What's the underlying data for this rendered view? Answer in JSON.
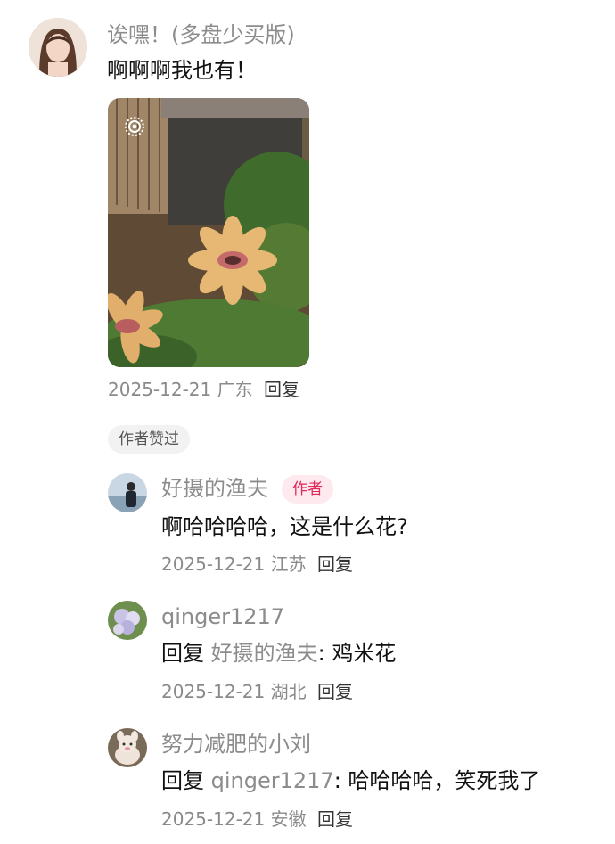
{
  "comments": [
    {
      "user": "诶嘿！(多盘少买版)",
      "text": "啊啊啊我也有！",
      "date": "2025-12-21",
      "location": "广东",
      "reply_label": "回复",
      "badge": "作者赞过"
    }
  ],
  "replies": [
    {
      "user": "好摄的渔夫",
      "author_tag": "作者",
      "text": "啊哈哈哈哈，这是什么花?",
      "date": "2025-12-21",
      "location": "江苏",
      "reply_label": "回复"
    },
    {
      "user": "qinger1217",
      "reply_prefix": "回复",
      "reply_to": "好摄的渔夫",
      "text": ": 鸡米花",
      "date": "2025-12-21",
      "location": "湖北",
      "reply_label": "回复"
    },
    {
      "user": "努力减肥的小刘",
      "reply_prefix": "回复",
      "reply_to": "qinger1217",
      "text": ": 哈哈哈哈，笑死我了",
      "date": "2025-12-21",
      "location": "安徽",
      "reply_label": "回复"
    }
  ],
  "icons": {
    "live_photo": "live-photo-icon"
  }
}
